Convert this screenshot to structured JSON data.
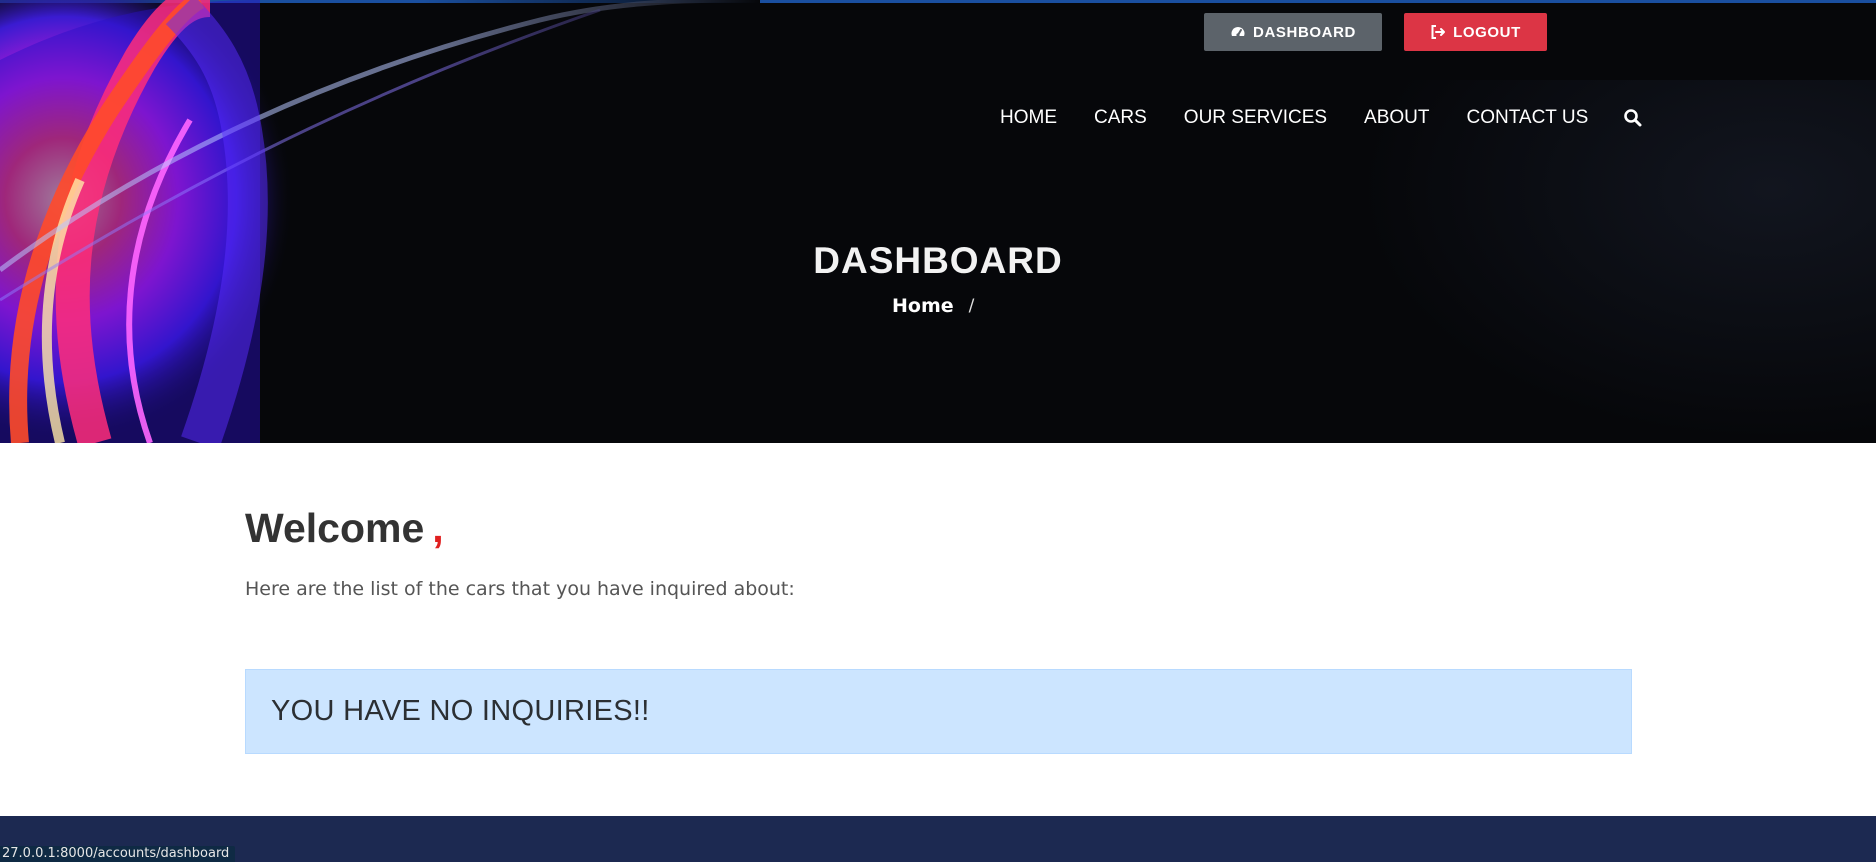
{
  "header": {
    "dashboard_button": {
      "label": "DASHBOARD",
      "icon": "dashboard-gauge-icon"
    },
    "logout_button": {
      "label": "LOGOUT",
      "icon": "sign-out-icon"
    }
  },
  "nav": {
    "items": [
      {
        "label": "HOME"
      },
      {
        "label": "CARS"
      },
      {
        "label": "OUR SERVICES"
      },
      {
        "label": "ABOUT"
      },
      {
        "label": "CONTACT US"
      }
    ],
    "search_icon": "search-icon"
  },
  "hero": {
    "title": "DASHBOARD",
    "breadcrumb": {
      "home": "Home",
      "separator": "/"
    }
  },
  "main": {
    "welcome": "Welcome",
    "welcome_comma": ",",
    "intro": "Here are the list of the cars that you have inquired about:",
    "alert": "YOU HAVE NO INQUIRIES!!"
  },
  "status_bar": {
    "url": "27.0.0.1:8000/accounts/dashboard"
  },
  "colors": {
    "dashboard_button": "#5c636a",
    "logout_button": "#dc3545",
    "alert_bg": "#cce5ff",
    "footer": "#1c2951",
    "accent_red": "#e02020"
  }
}
